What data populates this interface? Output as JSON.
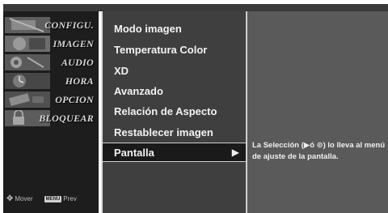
{
  "sidebar": {
    "items": [
      {
        "label": "CONFIGU."
      },
      {
        "label": "IMAGEN"
      },
      {
        "label": "AUDIO"
      },
      {
        "label": "HORA"
      },
      {
        "label": "OPCION"
      },
      {
        "label": "BLOQUEAR"
      }
    ],
    "footer": {
      "move_label": "Mover",
      "menu_key": "MENU",
      "prev_label": "Prev"
    }
  },
  "menu": {
    "items": [
      {
        "label": "Modo imagen"
      },
      {
        "label": "Temperatura Color"
      },
      {
        "label": "XD"
      },
      {
        "label": "Avanzado"
      },
      {
        "label": "Relación de Aspecto"
      },
      {
        "label": "Restablecer imagen"
      },
      {
        "label": "Pantalla"
      }
    ],
    "selected_arrow": "▶"
  },
  "help": {
    "line1": "La Selección (▶ó ⊙) lo lleva al menú",
    "line2": "de ajuste de la pantalla."
  }
}
